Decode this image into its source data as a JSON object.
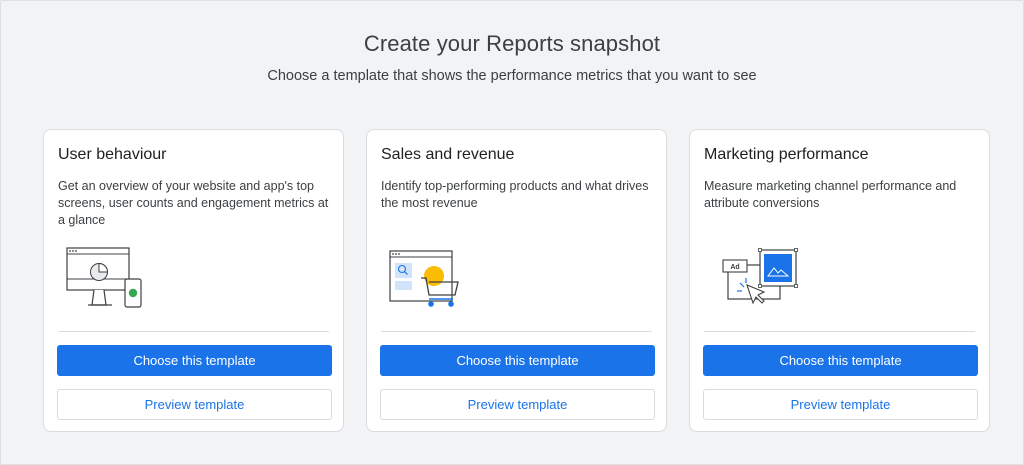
{
  "page": {
    "title": "Create your Reports snapshot",
    "subtitle": "Choose a template that shows the performance metrics that you want to see"
  },
  "colors": {
    "primary": "#1a73e8",
    "background": "#f1f3f4",
    "accent_green": "#34a853",
    "accent_yellow": "#fbbc04"
  },
  "cards": [
    {
      "title": "User behaviour",
      "description": "Get an overview of your website and app's top screens, user counts and engagement metrics at a glance",
      "illustration": "monitor-phone-illustration",
      "primary_label": "Choose this template",
      "secondary_label": "Preview template"
    },
    {
      "title": "Sales and revenue",
      "description": "Identify top-performing products and what drives the most revenue",
      "illustration": "browser-shopping-cart-illustration",
      "primary_label": "Choose this template",
      "secondary_label": "Preview template"
    },
    {
      "title": "Marketing performance",
      "description": "Measure marketing channel performance and attribute conversions",
      "illustration": "ad-cursor-illustration",
      "primary_label": "Choose this template",
      "secondary_label": "Preview template",
      "ad_badge": "Ad"
    }
  ]
}
